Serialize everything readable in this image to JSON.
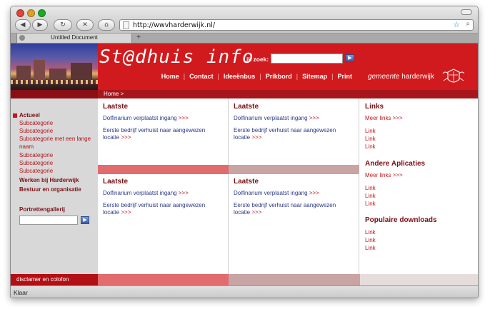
{
  "browser": {
    "url": "http://wwvharderwijk.nl/",
    "tab_title": "Untitled Document",
    "status": "Klaar",
    "back_glyph": "◀",
    "forward_glyph": "▶",
    "reload_glyph": "↻",
    "stop_glyph": "✕",
    "home_glyph": "⌂",
    "star_glyph": "☆",
    "search_glyph": "⌕",
    "newtab_glyph": "+"
  },
  "header": {
    "logo": "St@dhuis info",
    "search_label": "ik zoek:",
    "go_glyph": "▶",
    "nav": [
      "Home",
      "Contact",
      "Ideeënbus",
      "Prikbord",
      "Sitemap",
      "Print"
    ],
    "sep": "|",
    "gemeente_italic": "gemeente",
    "gemeente_plain": " harderwijk"
  },
  "breadcrumb": "Home >",
  "sidebar": {
    "actueel": "Actueel",
    "subs": [
      "Subcategorie",
      "Subcategorie",
      "Subcategorie met een lange",
      "naam",
      "Subcategorie",
      "Subcategorie",
      "Subcategorie"
    ],
    "werken": "Werken bij Harderwijk",
    "bestuur": "Bestuur en organisatie",
    "portret": "Portrettengallerij",
    "go_glyph": "▶"
  },
  "news": {
    "title": "Laatste",
    "item1": "Dolfinarium verplaatst ingang",
    "item2_line1": "Eerste bedrijf verhuist naar aangewezen",
    "item2_line2": "locatie",
    "more": ">>>"
  },
  "side": {
    "links_title": "Links",
    "meer_links": "Meer links >>>",
    "link": "Link",
    "apps_title": "Andere Aplicaties",
    "downloads_title": "Populaire downloads"
  },
  "footer": {
    "disclaimer": "disclamer en colofon"
  },
  "colors": {
    "brand_red": "#d11a1d",
    "dark_red": "#7a1014",
    "link_blue": "#2a3a8a"
  }
}
